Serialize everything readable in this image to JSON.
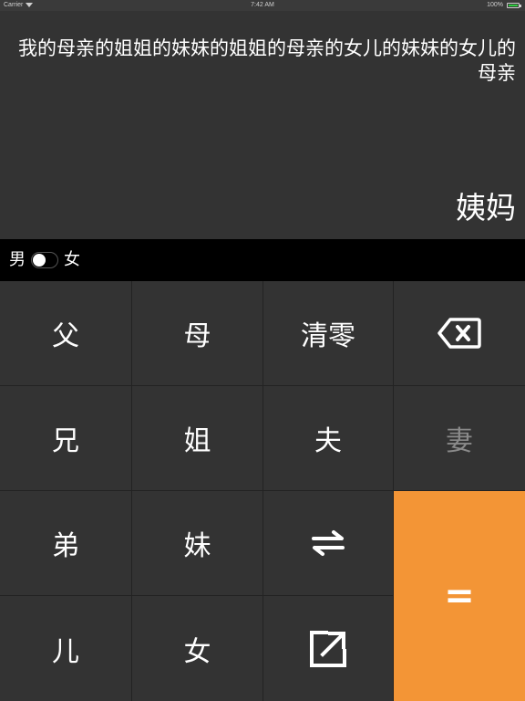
{
  "status_bar": {
    "carrier": "Carrier",
    "time": "7:42 AM",
    "battery": "100%"
  },
  "display": {
    "expression": "我的母亲的姐姐的妹妹的姐姐的母亲的女儿的妹妹的女儿的母亲",
    "result": "姨妈"
  },
  "gender": {
    "male_label": "男",
    "female_label": "女",
    "selected": "男"
  },
  "keys": {
    "father": "父",
    "mother": "母",
    "clear": "清零",
    "backspace_icon": "backspace-icon",
    "elder_brother": "兄",
    "elder_sister": "姐",
    "husband": "夫",
    "wife": "妻",
    "younger_brother": "弟",
    "younger_sister": "妹",
    "swap_icon": "swap-arrows-icon",
    "son": "儿",
    "daughter": "女",
    "share_icon": "share-external-icon",
    "equals": "="
  },
  "colors": {
    "background": "#333333",
    "gender_bar": "#000000",
    "accent": "#f39536",
    "disabled_key_text": "#8a8a8a"
  }
}
